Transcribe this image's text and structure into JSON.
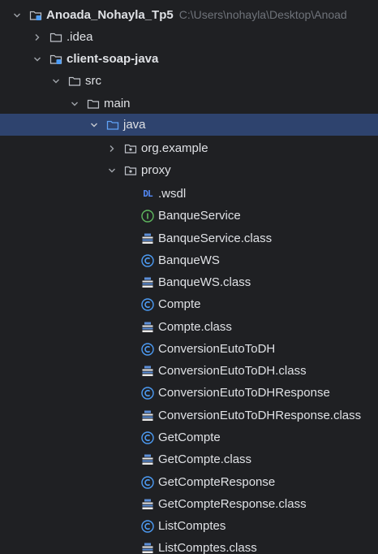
{
  "project_tree": {
    "root": {
      "label": "Anoada_Nohayla_Tp5",
      "path": "C:\\Users\\nohayla\\Desktop\\Anoad"
    },
    "idea": {
      "label": ".idea"
    },
    "module": {
      "label": "client-soap-java"
    },
    "src": {
      "label": "src"
    },
    "main": {
      "label": "main"
    },
    "java": {
      "label": "java"
    },
    "org_example": {
      "label": "org.example"
    },
    "proxy": {
      "label": "proxy"
    },
    "files": [
      {
        "label": ".wsdl",
        "icon": "wsdl-icon"
      },
      {
        "label": "BanqueService",
        "icon": "interface-icon"
      },
      {
        "label": "BanqueService.class",
        "icon": "class-file-icon"
      },
      {
        "label": "BanqueWS",
        "icon": "class-icon"
      },
      {
        "label": "BanqueWS.class",
        "icon": "class-file-icon"
      },
      {
        "label": "Compte",
        "icon": "class-icon"
      },
      {
        "label": "Compte.class",
        "icon": "class-file-icon"
      },
      {
        "label": "ConversionEutoToDH",
        "icon": "class-icon"
      },
      {
        "label": "ConversionEutoToDH.class",
        "icon": "class-file-icon"
      },
      {
        "label": "ConversionEutoToDHResponse",
        "icon": "class-icon"
      },
      {
        "label": "ConversionEutoToDHResponse.class",
        "icon": "class-file-icon"
      },
      {
        "label": "GetCompte",
        "icon": "class-icon"
      },
      {
        "label": "GetCompte.class",
        "icon": "class-file-icon"
      },
      {
        "label": "GetCompteResponse",
        "icon": "class-icon"
      },
      {
        "label": "GetCompteResponse.class",
        "icon": "class-file-icon"
      },
      {
        "label": "ListComptes",
        "icon": "class-icon"
      },
      {
        "label": "ListComptes.class",
        "icon": "class-file-icon"
      }
    ]
  },
  "colors": {
    "background": "#1f2023",
    "selection": "#2e436e",
    "text": "#dfe1e5",
    "muted": "#6f737a",
    "class_icon": "#4d9cf5",
    "interface_icon": "#5fb85f",
    "class_file_stripes": "#5d8fd8"
  }
}
